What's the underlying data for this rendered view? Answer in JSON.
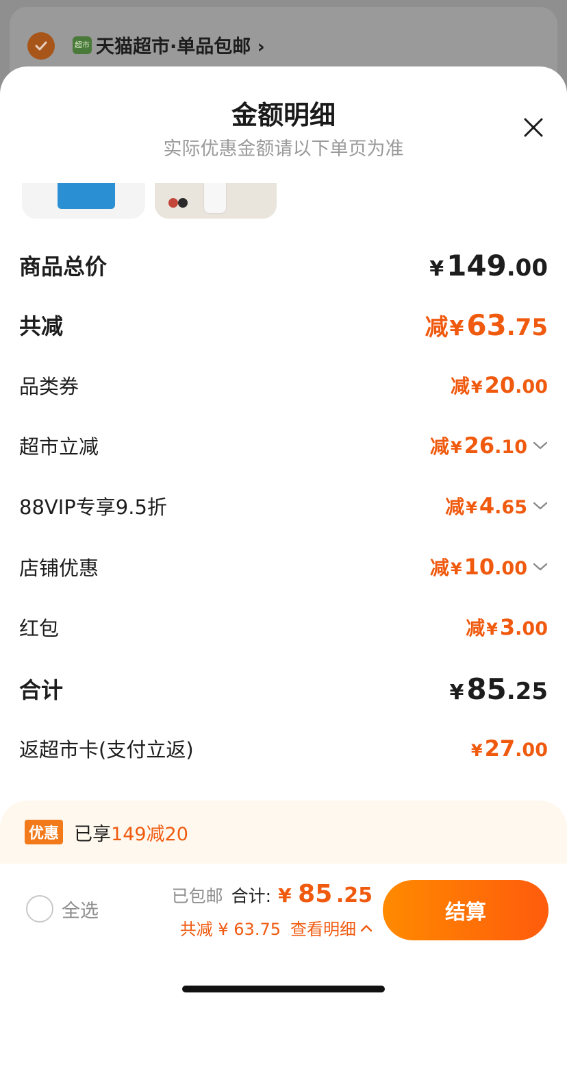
{
  "background": {
    "store_icon_text": "超市",
    "store_name": "天猫超市·单品包邮",
    "store_chevron": "›"
  },
  "sheet": {
    "title": "金额明细",
    "subtitle": "实际优惠金额请以下单页为准"
  },
  "rows": [
    {
      "label": "商品总价",
      "prefix": "",
      "yen": "¥",
      "int": "149",
      "dec": ".00"
    },
    {
      "label": "共减",
      "prefix": "减",
      "yen": "¥",
      "int": "63",
      "dec": ".75"
    },
    {
      "label": "品类券",
      "prefix": "减",
      "yen": "¥",
      "int": "20",
      "dec": ".00"
    },
    {
      "label": "超市立减",
      "prefix": "减",
      "yen": "¥",
      "int": "26",
      "dec": ".10"
    },
    {
      "label": "88VIP专享9.5折",
      "prefix": "减",
      "yen": "¥",
      "int": "4",
      "dec": ".65"
    },
    {
      "label": "店铺优惠",
      "prefix": "减",
      "yen": "¥",
      "int": "10",
      "dec": ".00"
    },
    {
      "label": "红包",
      "prefix": "减",
      "yen": "¥",
      "int": "3",
      "dec": ".00"
    },
    {
      "label": "合计",
      "prefix": "",
      "yen": "¥",
      "int": "85",
      "dec": ".25"
    },
    {
      "label": "返超市卡(支付立返)",
      "prefix": "",
      "yen": "¥",
      "int": "27",
      "dec": ".00"
    }
  ],
  "promo": {
    "tag": "优惠",
    "text": "已享",
    "highlight": "149减20"
  },
  "footer": {
    "select_all": "全选",
    "shipping": "已包邮",
    "total_label": "合计:",
    "total_yen": "¥",
    "total_int": "85",
    "total_dec": ".25",
    "saved": "共减 ¥ 63.75",
    "view_detail": "查看明细",
    "checkout": "结算"
  },
  "colors": {
    "accent": "#f05a0f",
    "checkout_gradient_start": "#ff8a00",
    "checkout_gradient_end": "#ff5b0c"
  }
}
